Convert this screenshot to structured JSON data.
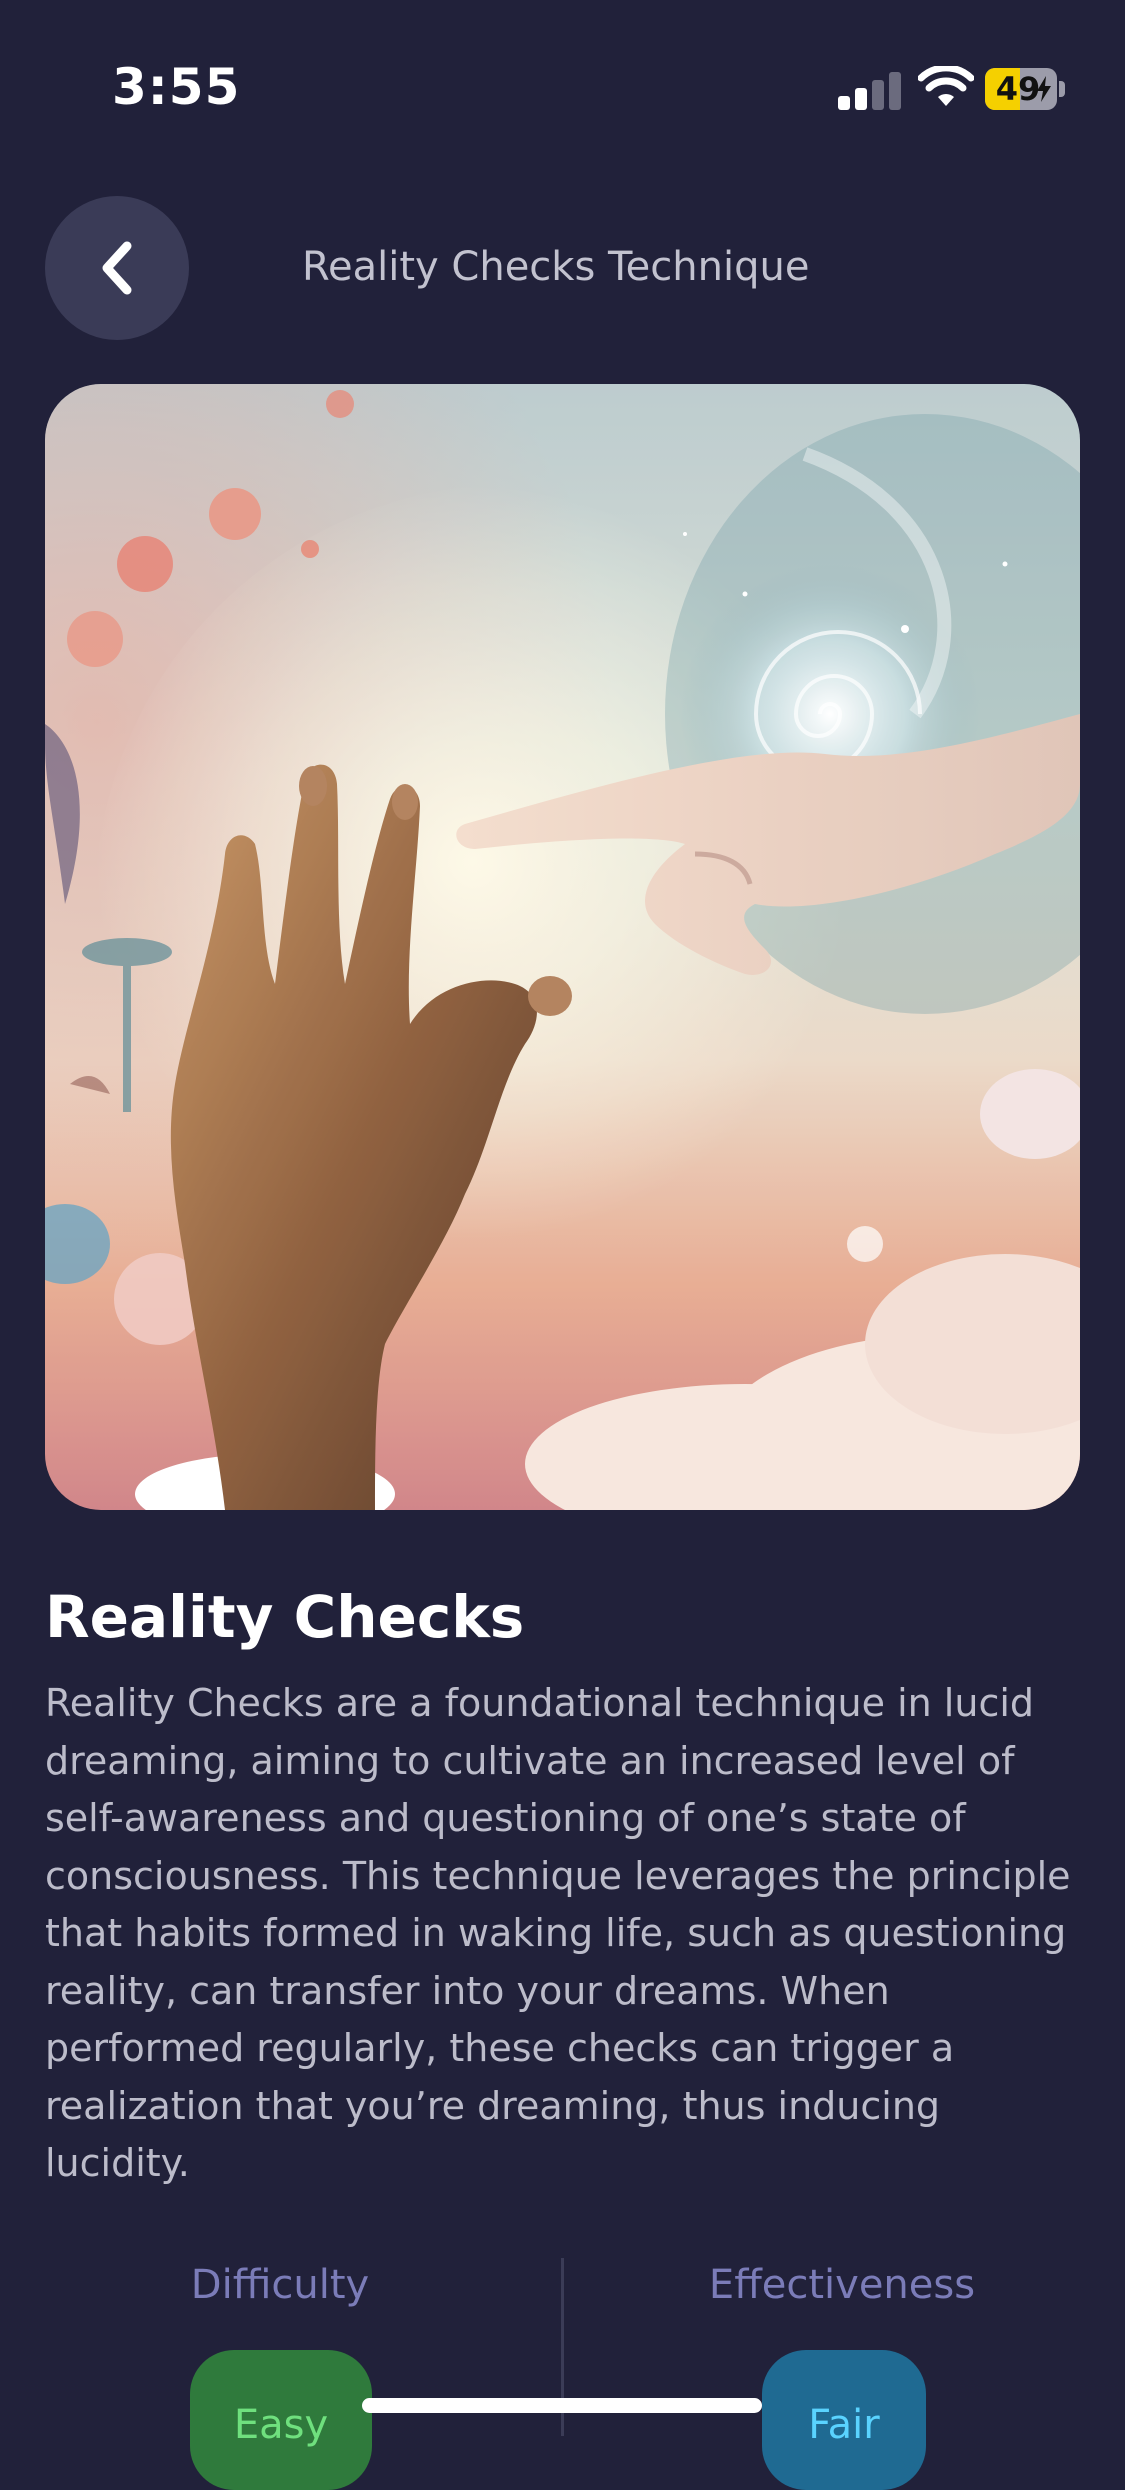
{
  "status_bar": {
    "time": "3:55",
    "battery_level": "49",
    "battery_fraction": 0.49
  },
  "header": {
    "title": "Reality Checks Technique"
  },
  "hero": {
    "icon": "hands-reaching-artwork"
  },
  "content": {
    "title": "Reality Checks",
    "description": "Reality Checks are a foundational technique in lucid dreaming, aiming to cultivate an increased level of self-awareness and questioning of one’s state of consciousness. This technique leverages the principle that habits formed in waking life, such as questioning reality, can transfer into your dreams. When performed regularly, these checks can trigger a realization that you’re dreaming, thus inducing lucidity."
  },
  "stats": {
    "difficulty_label": "Difficulty",
    "difficulty_value": "Easy",
    "effectiveness_label": "Effectiveness",
    "effectiveness_value": "Fair"
  },
  "colors": {
    "background": "#21213a",
    "accent_difficulty": "#2f7a3c",
    "accent_effectiveness": "#1f6a92",
    "label": "#7b7cb8"
  }
}
